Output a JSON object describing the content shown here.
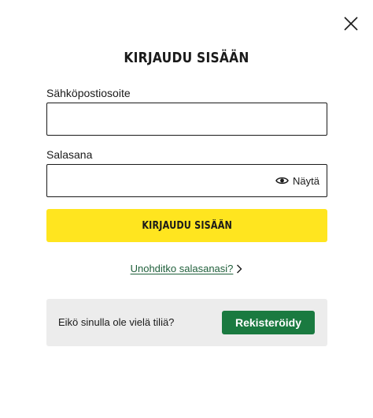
{
  "dialog": {
    "title": "KIRJAUDU SISÄÄN",
    "close_icon": "close-icon"
  },
  "form": {
    "email": {
      "label": "Sähköpostiosoite",
      "value": "",
      "placeholder": ""
    },
    "password": {
      "label": "Salasana",
      "value": "",
      "placeholder": "",
      "show_label": "Näytä",
      "show_icon": "eye-icon"
    },
    "submit_label": "KIRJAUDU SISÄÄN",
    "forgot_label": "Unohditko salasanasi?",
    "forgot_icon": "chevron-right-icon"
  },
  "register": {
    "prompt": "Eikö sinulla ole vielä tiliä?",
    "button_label": "Rekisteröidy"
  },
  "colors": {
    "primary_yellow": "#ffe51f",
    "brand_green": "#1a7a40",
    "link_green": "#1f5f3a",
    "panel_gray": "#ececec",
    "text": "#1a1a1a"
  }
}
